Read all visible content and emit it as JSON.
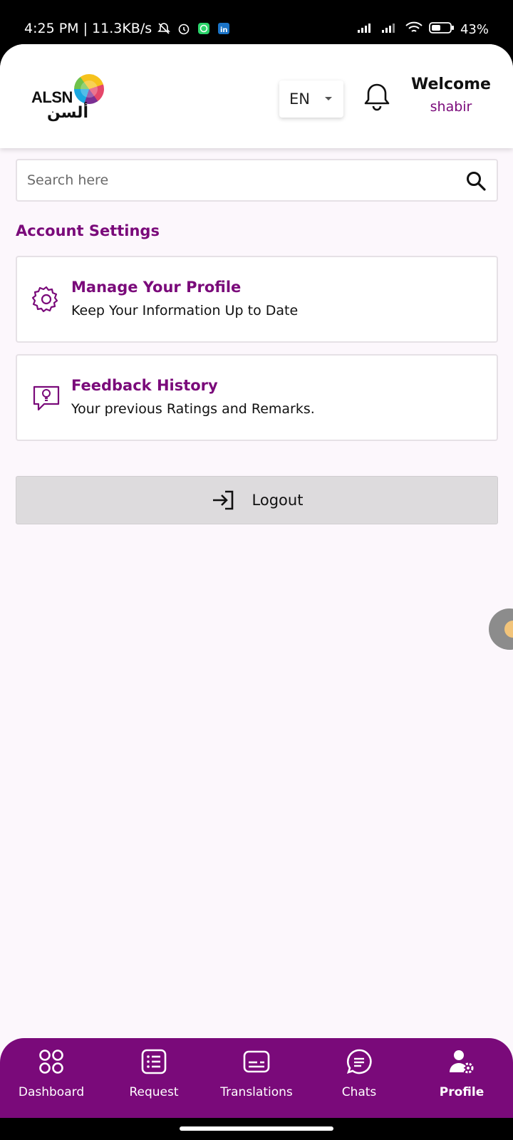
{
  "status_bar": {
    "time_and_speed": "4:25 PM | 11.3KB/s",
    "battery": "43%",
    "icons": [
      "mute-bell-icon",
      "alarm-icon",
      "whatsapp-icon",
      "linkedin-icon",
      "signal-icon",
      "signal-icon",
      "wifi-icon",
      "battery-icon"
    ]
  },
  "header": {
    "logo_text": "ALSN",
    "logo_arabic": "ألسن",
    "language": "EN",
    "welcome_label": "Welcome",
    "username": "shabir"
  },
  "search": {
    "placeholder": "Search here"
  },
  "account_settings": {
    "title": "Account Settings",
    "cards": [
      {
        "title": "Manage Your Profile",
        "subtitle": "Keep Your Information Up to Date",
        "icon": "gear-icon"
      },
      {
        "title": "Feedback History",
        "subtitle": "Your previous Ratings and Remarks.",
        "icon": "feedback-lightbulb-icon"
      }
    ]
  },
  "logout_label": "Logout",
  "bottom_nav": {
    "items": [
      {
        "label": "Dashboard",
        "icon": "dashboard-grid-icon"
      },
      {
        "label": "Request",
        "icon": "list-icon"
      },
      {
        "label": "Translations",
        "icon": "subtitles-icon"
      },
      {
        "label": "Chats",
        "icon": "chat-icon"
      },
      {
        "label": "Profile",
        "icon": "user-gear-icon",
        "active": true
      }
    ]
  },
  "colors": {
    "accent": "#7a0a7a",
    "background": "#fcf7fc",
    "logout_bg": "#dddbdd"
  }
}
